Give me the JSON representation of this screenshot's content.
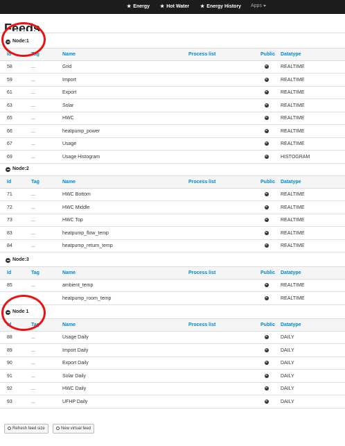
{
  "navbar": {
    "items": [
      {
        "label": "Energy",
        "icon": "star-icon"
      },
      {
        "label": "Hot Water",
        "icon": "star-icon"
      },
      {
        "label": "Energy History",
        "icon": "star-icon"
      }
    ],
    "apps_label": "Apps"
  },
  "page": {
    "title": "Feeds"
  },
  "columns": {
    "id": "Id",
    "tag": "Tag",
    "name": "Name",
    "process": "Process list",
    "public": "Public",
    "datatype": "Datatype"
  },
  "groups": [
    {
      "label": "Node:1",
      "rows": [
        {
          "id": "58",
          "tag": "...",
          "name": "Grid",
          "process": "",
          "datatype": "REALTIME"
        },
        {
          "id": "59",
          "tag": "...",
          "name": "Import",
          "process": "",
          "datatype": "REALTIME"
        },
        {
          "id": "61",
          "tag": "...",
          "name": "Export",
          "process": "",
          "datatype": "REALTIME"
        },
        {
          "id": "63",
          "tag": "...",
          "name": "Solar",
          "process": "",
          "datatype": "REALTIME"
        },
        {
          "id": "65",
          "tag": "...",
          "name": "HWC",
          "process": "",
          "datatype": "REALTIME"
        },
        {
          "id": "66",
          "tag": "...",
          "name": "heatpump_power",
          "process": "",
          "datatype": "REALTIME"
        },
        {
          "id": "67",
          "tag": "...",
          "name": "Usage",
          "process": "",
          "datatype": "REALTIME"
        },
        {
          "id": "69",
          "tag": "...",
          "name": "Usage Histogram",
          "process": "",
          "datatype": "HISTOGRAM"
        }
      ]
    },
    {
      "label": "Node:2",
      "rows": [
        {
          "id": "71",
          "tag": "...",
          "name": "HWC Bottom",
          "process": "",
          "datatype": "REALTIME"
        },
        {
          "id": "72",
          "tag": "...",
          "name": "HWC Middle",
          "process": "",
          "datatype": "REALTIME"
        },
        {
          "id": "73",
          "tag": "...",
          "name": "HWC Top",
          "process": "",
          "datatype": "REALTIME"
        },
        {
          "id": "83",
          "tag": "...",
          "name": "heatpump_flow_temp",
          "process": "",
          "datatype": "REALTIME"
        },
        {
          "id": "84",
          "tag": "...",
          "name": "heatpump_return_temp",
          "process": "",
          "datatype": "REALTIME"
        }
      ]
    },
    {
      "label": "Node:3",
      "rows": [
        {
          "id": "85",
          "tag": "...",
          "name": "ambient_temp",
          "process": "",
          "datatype": "REALTIME"
        },
        {
          "id": "",
          "tag": "...",
          "name": "heatpump_room_temp",
          "process": "",
          "datatype": "REALTIME"
        }
      ]
    },
    {
      "label": "Node 1",
      "rows": [
        {
          "id": "88",
          "tag": "...",
          "name": "Usage Daily",
          "process": "",
          "datatype": "DAILY"
        },
        {
          "id": "89",
          "tag": "...",
          "name": "Import Daily",
          "process": "",
          "datatype": "DAILY"
        },
        {
          "id": "90",
          "tag": "...",
          "name": "Export Daily",
          "process": "",
          "datatype": "DAILY"
        },
        {
          "id": "91",
          "tag": "...",
          "name": "Solar Daily",
          "process": "",
          "datatype": "DAILY"
        },
        {
          "id": "92",
          "tag": "...",
          "name": "HWC Daily",
          "process": "",
          "datatype": "DAILY"
        },
        {
          "id": "93",
          "tag": "...",
          "name": "UFHP Daily",
          "process": "",
          "datatype": "DAILY"
        }
      ]
    }
  ],
  "buttons": {
    "refresh": "Refresh feed size",
    "new_virtual": "New virtual feed"
  },
  "colors": {
    "navbar": "#1c1c1c",
    "link": "#0088cc",
    "annotation": "#ee1111"
  }
}
